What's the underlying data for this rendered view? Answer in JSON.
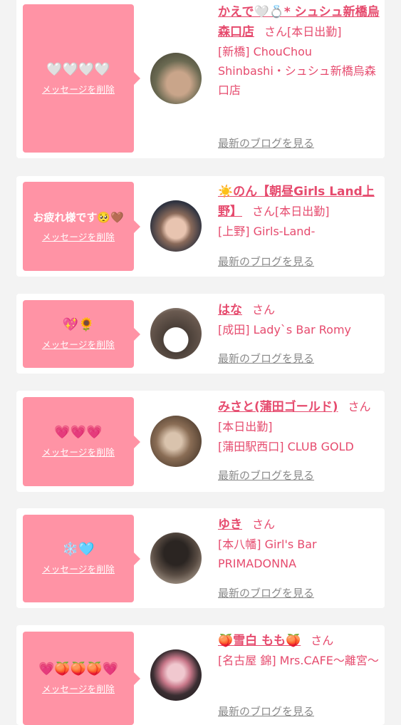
{
  "messages": [
    {
      "bubble_text": "🤍🤍🤍🤍",
      "delete_label": "メッセージを削除",
      "name": "かえで🤍💍* シュシュ新橋烏森口店",
      "san": "さん",
      "status": "[本日出勤]",
      "shop": "[新橋] ChouChou Shinbashi・シュシュ新橋烏森口店",
      "blog_label": "最新のブログを見る",
      "avatar_colors": [
        "#6b6a52",
        "#c9a58a"
      ]
    },
    {
      "bubble_text": "お疲れ様です🥺🤎",
      "delete_label": "メッセージを削除",
      "name": "☀️のん【朝昼Girls Land上野】",
      "san": "さん",
      "status": "[本日出勤]",
      "shop": "[上野] Girls-Land-",
      "blog_label": "最新のブログを見る",
      "avatar_colors": [
        "#2f3340",
        "#e8c4b0"
      ]
    },
    {
      "bubble_text": "💖🌻",
      "delete_label": "メッセージを削除",
      "name": "はな",
      "san": "さん",
      "status": "",
      "shop": "[成田] Lady`s Bar Romy",
      "blog_label": "最新のブログを見る",
      "avatar_colors": [
        "#4a3f38",
        "#ffffff"
      ]
    },
    {
      "bubble_text": "💗💗💗",
      "delete_label": "メッセージを削除",
      "name": "みさと(蒲田ゴールド)",
      "san": "さん",
      "status": "[本日出勤]",
      "shop": "[蒲田駅西口] CLUB GOLD",
      "blog_label": "最新のブログを見る",
      "avatar_colors": [
        "#5a4636",
        "#d9c3ad"
      ]
    },
    {
      "bubble_text": "❄️🩵",
      "delete_label": "メッセージを削除",
      "name": "ゆき",
      "san": "さん",
      "status": "",
      "shop": "[本八幡] Girl's Bar PRIMADONNA",
      "blog_label": "最新のブログを見る",
      "avatar_colors": [
        "#2b2522",
        "#a89a8c"
      ]
    },
    {
      "bubble_text": "💗🍑🍑🍑💗",
      "delete_label": "メッセージを削除",
      "name": "🍑雪白 もも🍑",
      "san": "さん",
      "status": "",
      "shop": "[名古屋 錦] Mrs.CAFE〜離宮〜",
      "blog_label": "最新のブログを見る",
      "avatar_colors": [
        "#1e1a1c",
        "#f0c8cf"
      ]
    }
  ]
}
